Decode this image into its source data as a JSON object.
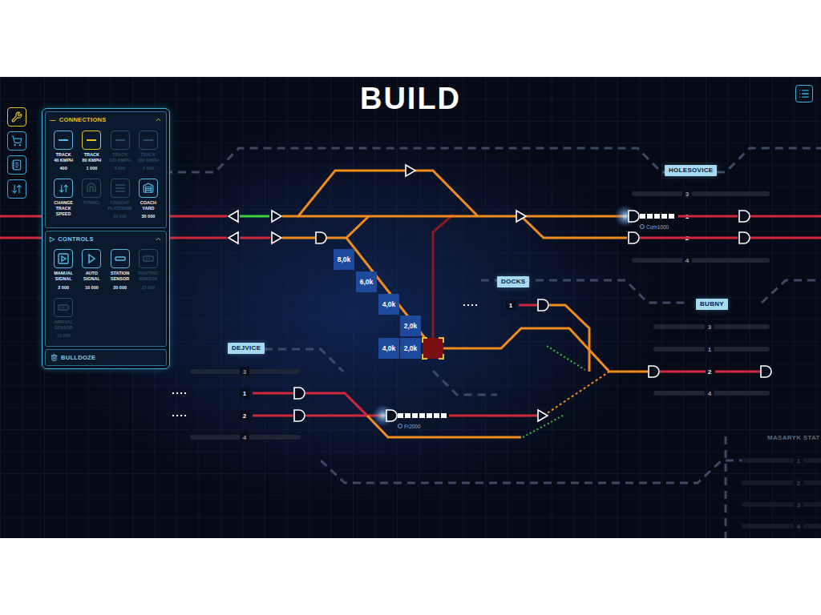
{
  "title": "BUILD",
  "toolbar": [
    {
      "kind": "wrench",
      "selected": true
    },
    {
      "kind": "cart",
      "selected": false
    },
    {
      "kind": "book",
      "selected": false
    },
    {
      "kind": "swap",
      "selected": false
    }
  ],
  "panel": {
    "sections": [
      {
        "title": "CONNECTIONS",
        "marker": "—",
        "expanded": true,
        "active": true,
        "items": [
          {
            "kind": "track",
            "lines": [
              "TRACK",
              "40 KMPH"
            ],
            "price": "400",
            "selected": false,
            "disabled": false
          },
          {
            "kind": "track",
            "lines": [
              "TRACK",
              "80 KMPH"
            ],
            "price": "1 000",
            "selected": true,
            "disabled": false
          },
          {
            "kind": "track",
            "lines": [
              "TRACK",
              "120 KMPH"
            ],
            "price": "2 000",
            "selected": false,
            "disabled": true
          },
          {
            "kind": "track",
            "lines": [
              "TRACK",
              "160 KMPH"
            ],
            "price": "5 000",
            "selected": false,
            "disabled": true
          },
          {
            "kind": "speed",
            "lines": [
              "CHANGE",
              "TRACK SPEED"
            ],
            "price": "",
            "selected": false,
            "disabled": false
          },
          {
            "kind": "tunnel",
            "lines": [
              "TUNNEL"
            ],
            "price": "",
            "selected": false,
            "disabled": true
          },
          {
            "kind": "platform",
            "lines": [
              "FREIGHT",
              "PLATFORM"
            ],
            "price": "30 000",
            "selected": false,
            "disabled": true
          },
          {
            "kind": "yard",
            "lines": [
              "COACH",
              "YARD"
            ],
            "price": "30 000",
            "selected": false,
            "disabled": false
          }
        ]
      },
      {
        "title": "CONTROLS",
        "marker": "▷",
        "expanded": true,
        "active": false,
        "items": [
          {
            "kind": "manual-signal",
            "lines": [
              "MANUAL",
              "SIGNAL"
            ],
            "price": "2 000",
            "selected": false,
            "disabled": false
          },
          {
            "kind": "auto-signal",
            "lines": [
              "AUTO",
              "SIGNAL"
            ],
            "price": "10 000",
            "selected": false,
            "disabled": false
          },
          {
            "kind": "station-sensor",
            "lines": [
              "STATION",
              "SENSOR"
            ],
            "price": "20 000",
            "selected": false,
            "disabled": false
          },
          {
            "kind": "routing-sensor",
            "lines": [
              "ROUTING",
              "SENSOR"
            ],
            "price": "25 000",
            "selected": false,
            "disabled": true
          },
          {
            "kind": "arrival-sensor",
            "lines": [
              "ARRIVAL",
              "SENSOR"
            ],
            "price": "15 000",
            "selected": false,
            "disabled": true
          }
        ]
      }
    ],
    "bulldoze": "BULLDOZE"
  },
  "stations": [
    {
      "name": "HOLESOVICE",
      "tracks": [
        {
          "number": "3",
          "active": false
        },
        {
          "number": "1",
          "active": true
        },
        {
          "number": "2",
          "active": true
        },
        {
          "number": "4",
          "active": false
        }
      ]
    },
    {
      "name": "DOCKS",
      "tracks": [
        {
          "number": "1",
          "active": true
        }
      ]
    },
    {
      "name": "BUBNY",
      "tracks": [
        {
          "number": "3",
          "active": false
        },
        {
          "number": "1",
          "active": false
        },
        {
          "number": "2",
          "active": true
        },
        {
          "number": "4",
          "active": false
        }
      ]
    },
    {
      "name": "DEJVICE",
      "tracks": [
        {
          "number": "3",
          "active": false
        },
        {
          "number": "1",
          "active": true
        },
        {
          "number": "2",
          "active": true
        },
        {
          "number": "4",
          "active": false
        }
      ]
    },
    {
      "name": "MASARYK STAT",
      "tracks": [
        {
          "number": "1",
          "active": false
        },
        {
          "number": "2",
          "active": false
        },
        {
          "number": "3",
          "active": false
        },
        {
          "number": "4",
          "active": false
        }
      ]
    }
  ],
  "costs": [
    "8,0k",
    "6,0k",
    "4,0k",
    "2,0k",
    "4,0k",
    "2,0k"
  ],
  "trains": [
    {
      "label": "Com1000"
    },
    {
      "label": "Fr2000"
    }
  ]
}
